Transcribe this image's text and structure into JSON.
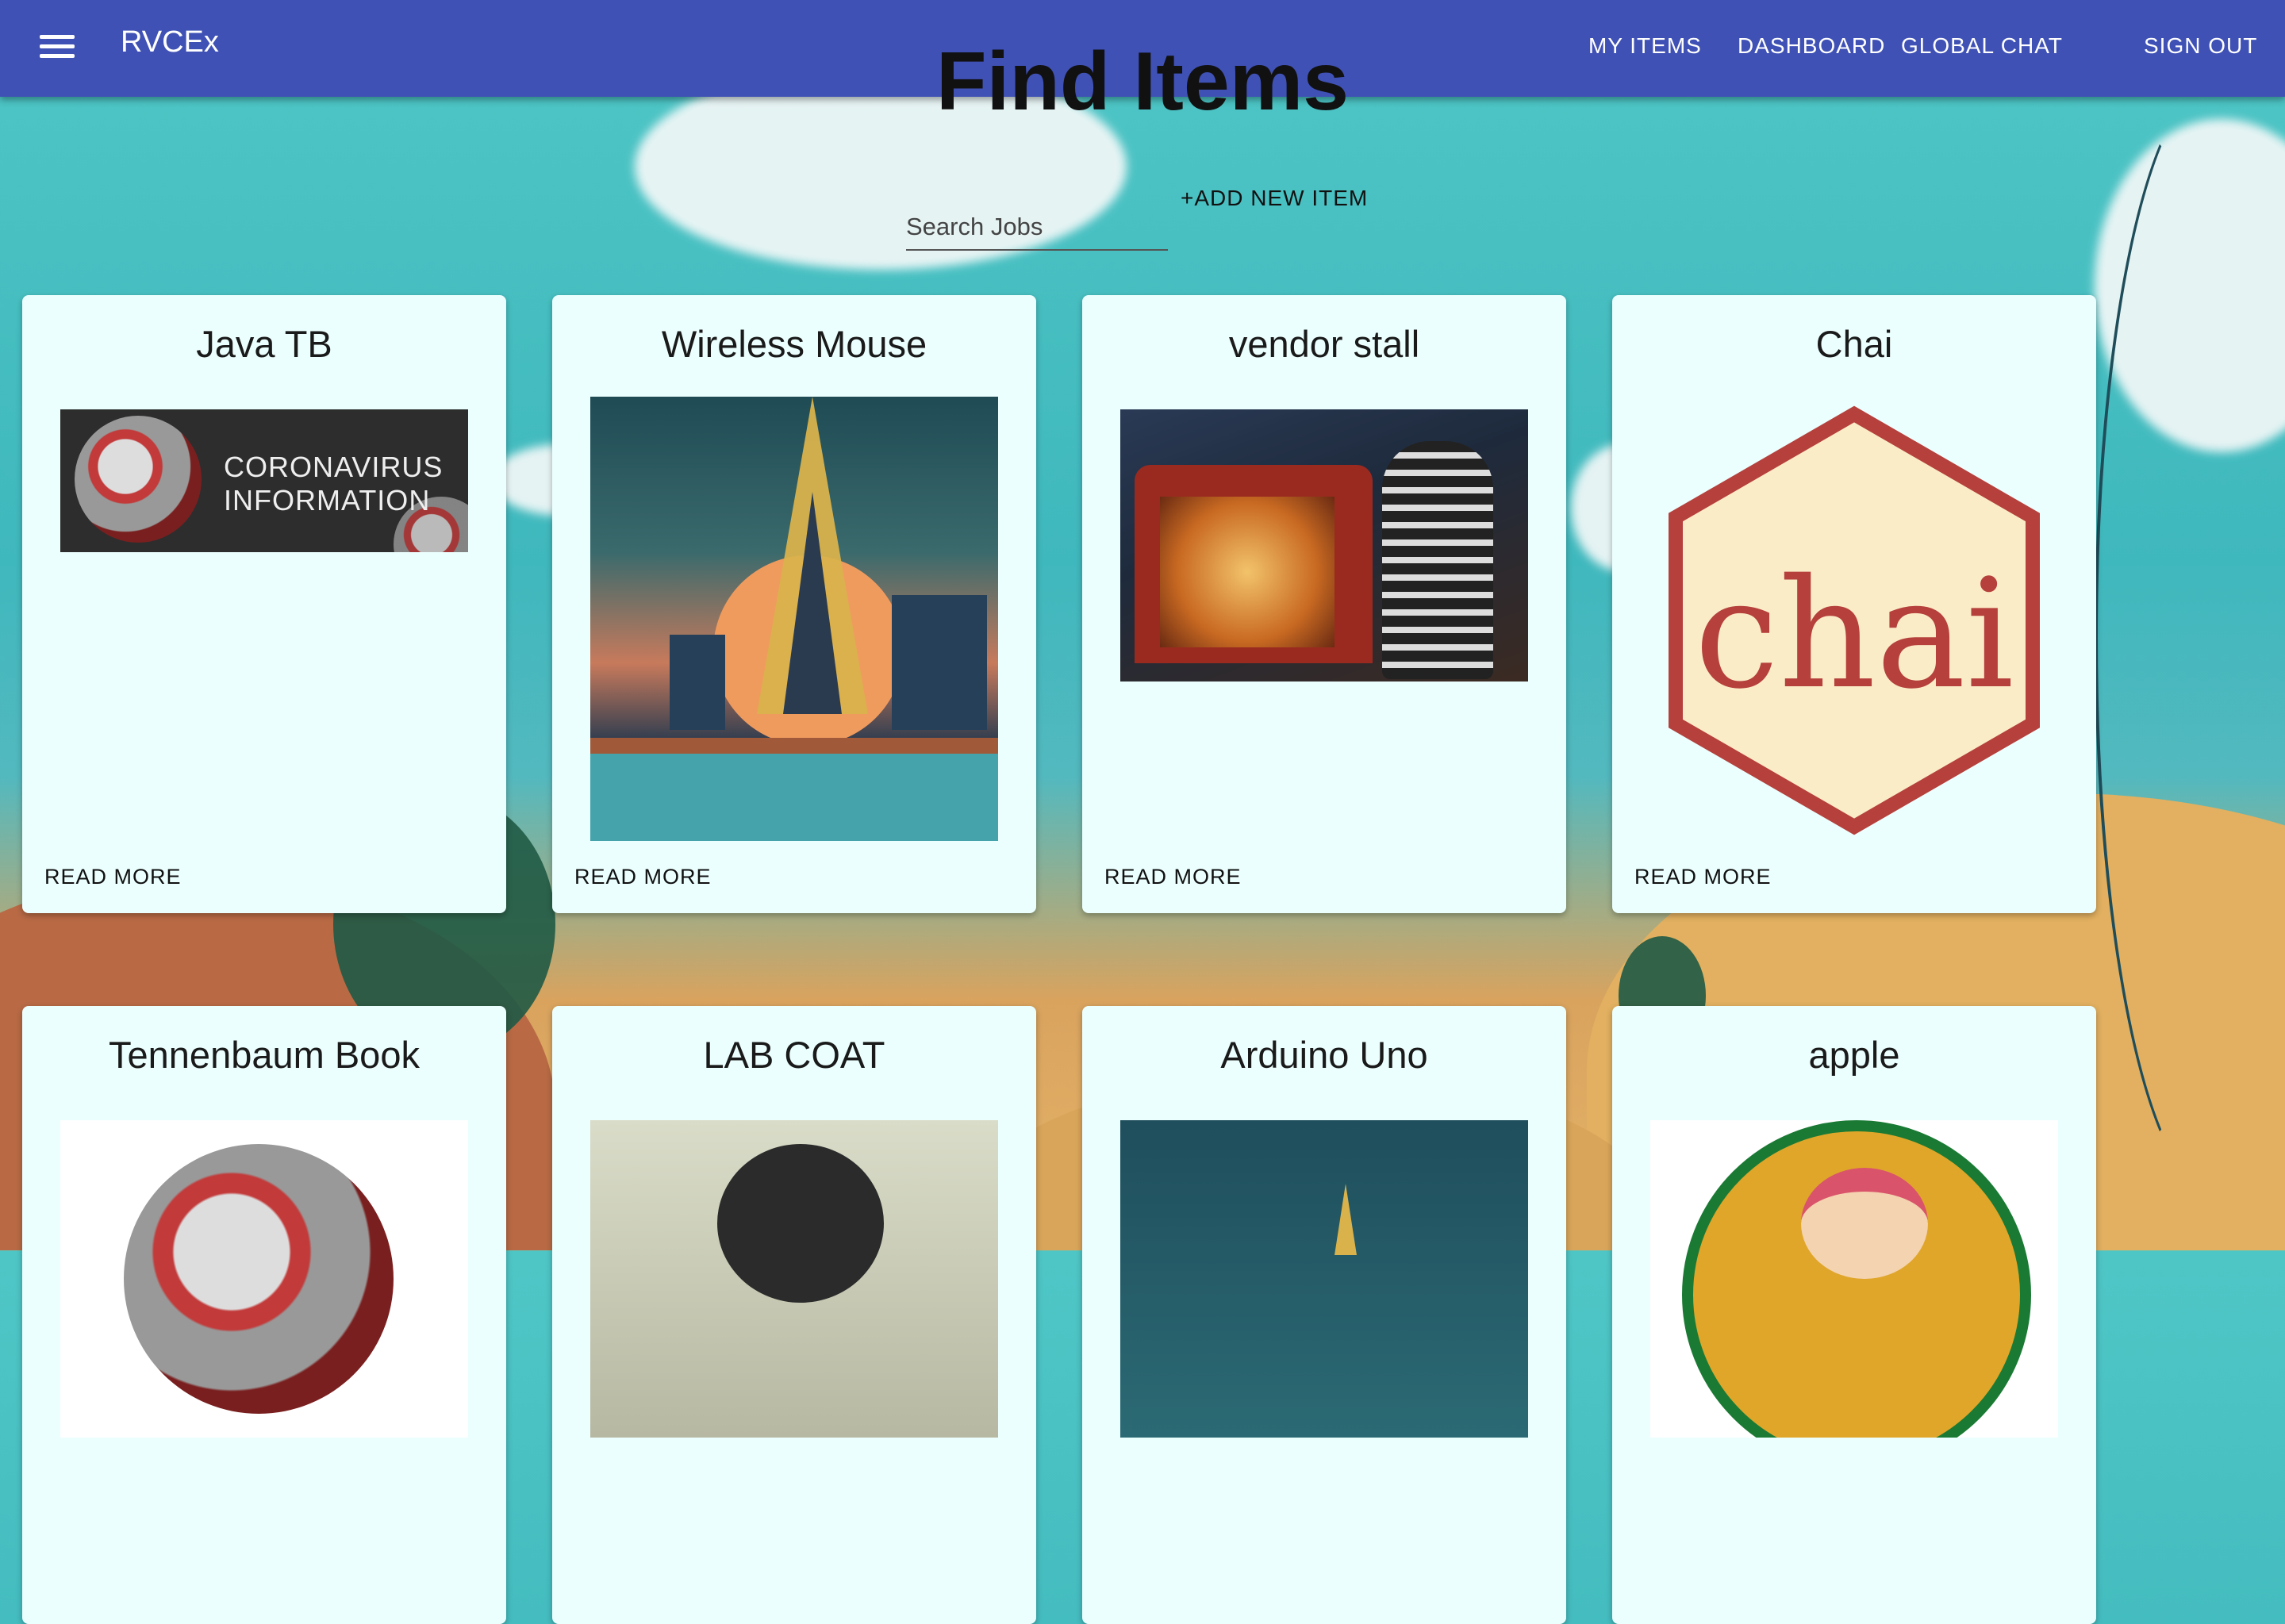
{
  "app": {
    "brand": "RVCEx"
  },
  "nav": {
    "my_items": "MY ITEMS",
    "dashboard": "DASHBOARD",
    "global_chat": "GLOBAL CHAT",
    "sign_out": "SIGN OUT"
  },
  "page": {
    "title": "Find Items"
  },
  "search": {
    "placeholder": "Search Jobs"
  },
  "actions": {
    "add_new_item": "+ADD NEW ITEM"
  },
  "colors": {
    "appbar": "#3f51b5",
    "card": "#ebfffe"
  },
  "cards": [
    {
      "title": "Java TB",
      "read_more": "READ MORE",
      "image": "coronavirus-information-banner",
      "image_text": [
        "CORONAVIRUS",
        "INFORMATION"
      ]
    },
    {
      "title": "Wireless Mouse",
      "read_more": "READ MORE",
      "image": "eiffel-tower-illustration"
    },
    {
      "title": "vendor stall",
      "read_more": "READ MORE",
      "image": "street-food-vendor-photo"
    },
    {
      "title": "Chai",
      "read_more": "READ MORE",
      "image": "chai-hexagon-logo",
      "image_text": "chai"
    },
    {
      "title": "Tennenbaum Book",
      "image": "virus-illustration"
    },
    {
      "title": "LAB COAT",
      "image": "person-photo"
    },
    {
      "title": "Arduino Uno",
      "image": "night-tower-illustration"
    },
    {
      "title": "apple",
      "image": "cartoon-badge"
    }
  ]
}
